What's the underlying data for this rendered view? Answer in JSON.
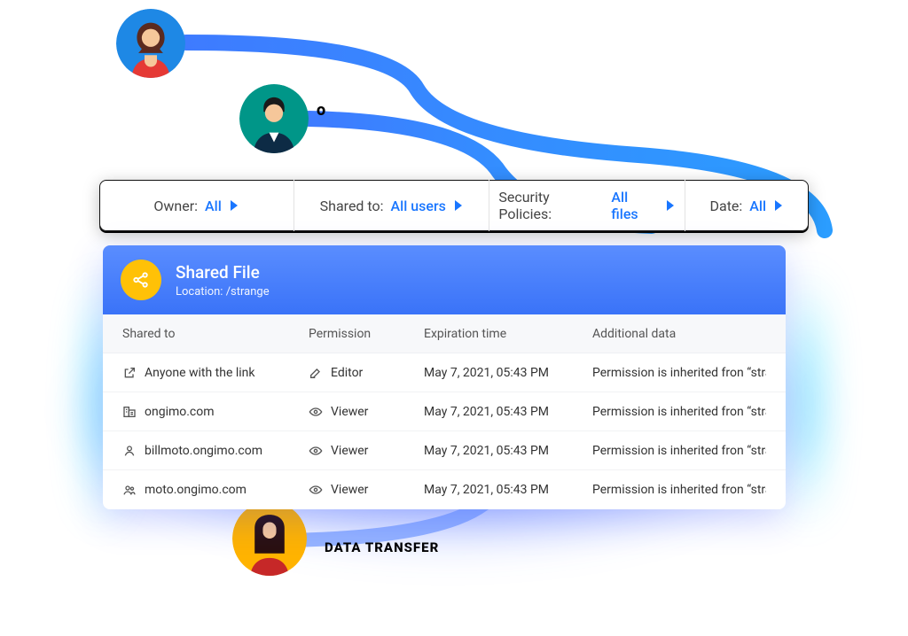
{
  "decor": {
    "partial_text": "o",
    "bottom_label": "DATA TRANSFER",
    "avatars": {
      "top1_icon": "woman-red-avatar",
      "top2_icon": "man-teal-avatar",
      "bottom_icon": "woman-yellow-avatar"
    }
  },
  "filters": [
    {
      "label": "Owner:",
      "value": "All",
      "caret_icon": "caret-right-icon"
    },
    {
      "label": "Shared to:",
      "value": "All users",
      "caret_icon": "caret-right-icon"
    },
    {
      "label": "Security Policies:",
      "value": "All files",
      "caret_icon": "caret-right-icon"
    },
    {
      "label": "Date:",
      "value": "All",
      "caret_icon": "caret-right-icon"
    }
  ],
  "panel": {
    "icon": "share-icon",
    "title": "Shared File",
    "location_label": "Location:",
    "location_value": "/strange",
    "columns": {
      "c1": "Shared to",
      "c2": "Permission",
      "c3": "Expiration time",
      "c4": "Additional data"
    },
    "rows": [
      {
        "shared_icon": "external-link-icon",
        "shared_to": "Anyone with the link",
        "perm_icon": "pencil-icon",
        "permission": "Editor",
        "expiration": "May 7, 2021, 05:43 PM",
        "additional": "Permission is inherited fron “strange’"
      },
      {
        "shared_icon": "domain-icon",
        "shared_to": "ongimo.com",
        "perm_icon": "eye-icon",
        "permission": "Viewer",
        "expiration": "May 7, 2021, 05:43 PM",
        "additional": "Permission is inherited fron “strange’"
      },
      {
        "shared_icon": "person-icon",
        "shared_to": "billmoto.ongimo.com",
        "perm_icon": "eye-icon",
        "permission": "Viewer",
        "expiration": "May 7, 2021, 05:43 PM",
        "additional": "Permission is inherited fron “strange’"
      },
      {
        "shared_icon": "people-icon",
        "shared_to": "moto.ongimo.com",
        "perm_icon": "eye-icon",
        "permission": "Viewer",
        "expiration": "May 7, 2021, 05:43 PM",
        "additional": "Permission is inherited fron “strange’"
      }
    ]
  }
}
